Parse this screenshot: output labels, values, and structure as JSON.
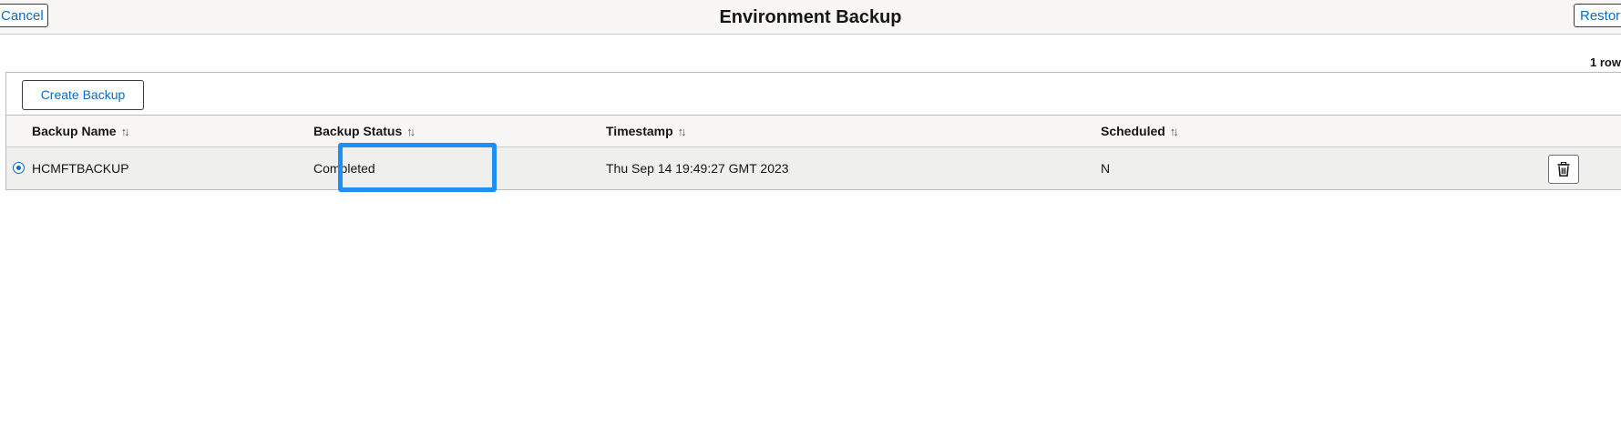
{
  "header": {
    "title": "Environment Backup",
    "cancel_label": "Cancel",
    "restore_label": "Restore"
  },
  "grid": {
    "row_count": "1 row",
    "create_label": "Create Backup",
    "columns": [
      "Backup Name",
      "Backup Status",
      "Timestamp",
      "Scheduled"
    ],
    "rows": [
      {
        "selected": true,
        "name": "HCMFTBACKUP",
        "status": "Completed",
        "timestamp": "Thu Sep 14 19:49:27 GMT 2023",
        "scheduled": "N",
        "action_icon": "trash-icon"
      }
    ]
  },
  "colors": {
    "link_blue": "#0a6cc2",
    "highlight_blue": "#1e8ff5"
  }
}
